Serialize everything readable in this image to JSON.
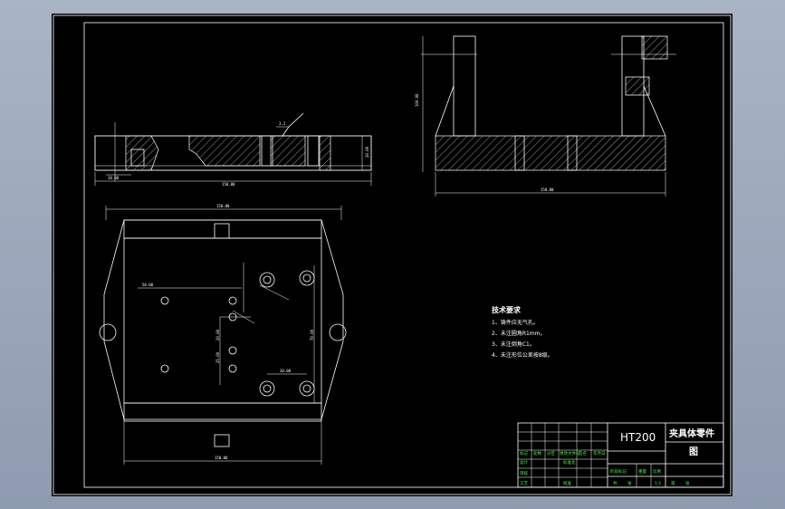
{
  "drawing": {
    "tech_requirements_title": "技术要求",
    "tech_requirements": [
      "1、铸件应无气孔。",
      "2、未注圆角R1mm。",
      "3、未注倒角C1。",
      "4、未注形位公差按8级。"
    ],
    "roughness_mark": "3.2",
    "dimensions": {
      "top_length": "150.00",
      "top_height": "20.00",
      "top_left_small": "18.00",
      "side_length": "150.00",
      "side_height": "100.00",
      "plan_width": "150.00",
      "plan_bottom": "150.00",
      "plan_left_mid": "50.00",
      "plan_hole_a": "20.00",
      "plan_hole_b": "25.00",
      "plan_hole_c": "20.00",
      "plan_right": "70.00"
    }
  },
  "title_block": {
    "material": "HT200",
    "part_name": "夹具体零件",
    "sheet_type": "图",
    "scale": "1:1",
    "left_labels": [
      "标记",
      "处数",
      "分区",
      "更改文件号",
      "签名",
      "年月日"
    ],
    "row_labels": [
      "设计",
      "标准化",
      "审核",
      "工艺",
      "批准"
    ],
    "stage_labels": [
      "阶段标记",
      "重量",
      "比例"
    ],
    "bottom_labels": [
      "共",
      "张",
      "第",
      "张"
    ]
  },
  "colors": {
    "frame": "#ffffff",
    "title_text": "#3cff3c",
    "background": "#000000"
  }
}
